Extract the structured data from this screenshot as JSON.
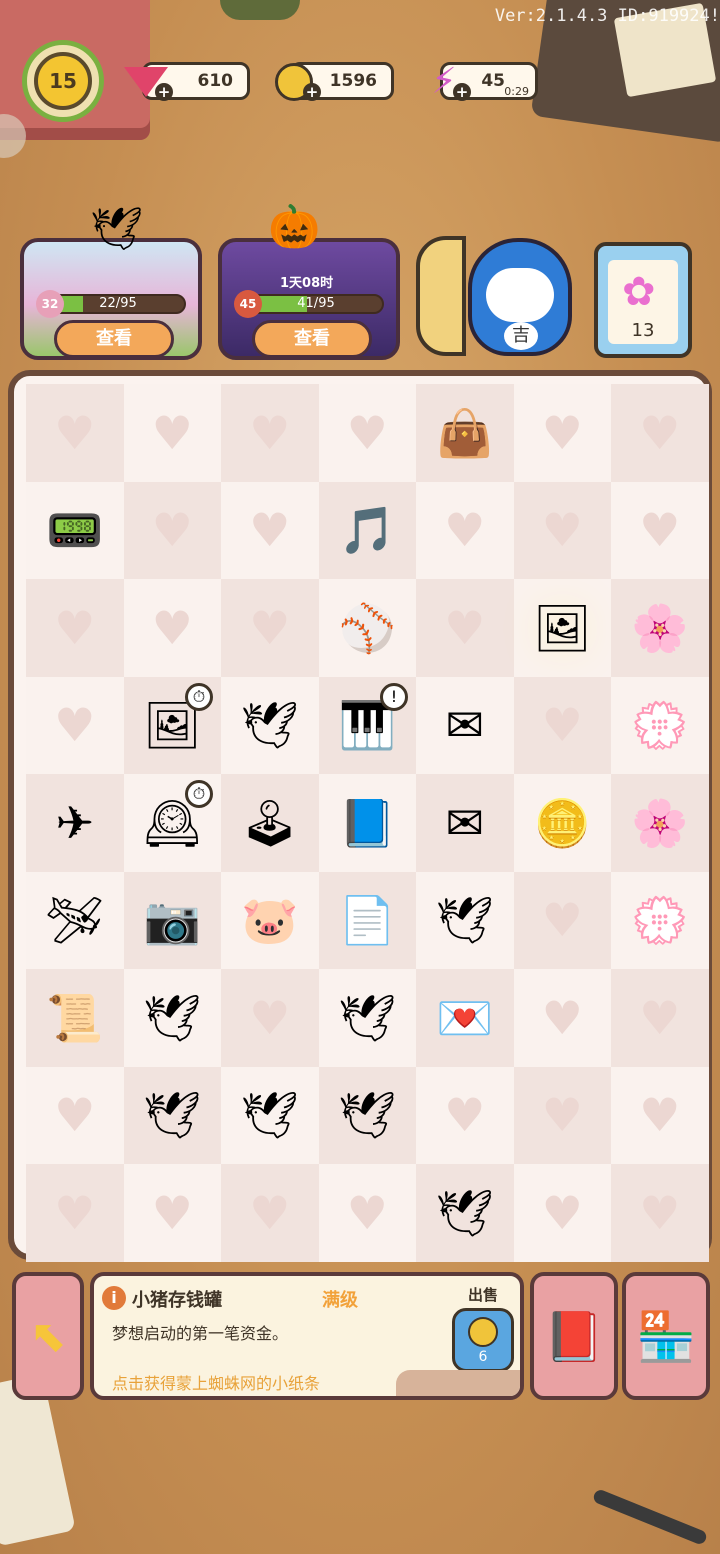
{
  "version": "Ver:2.1.4.3 ID:919924!",
  "player": {
    "level": "15"
  },
  "resources": {
    "gems": {
      "value": "610",
      "icon": "gem-icon",
      "color": "#e0446a"
    },
    "coins": {
      "value": "1596",
      "icon": "coin-icon",
      "color": "#f0c43a"
    },
    "energy": {
      "value": "45",
      "timer": "0:29",
      "icon": "lightning-icon",
      "color": "#d25cc8"
    }
  },
  "events": [
    {
      "name": "sakura-event",
      "level": "32",
      "progress_text": "22/95",
      "progress": 0.2316,
      "button": "查看"
    },
    {
      "name": "halloween-event",
      "level": "45",
      "progress_text": "41/95",
      "progress": 0.4316,
      "timer": "1天08时",
      "button": "查看"
    }
  ],
  "side_widgets": {
    "daruma_mark": "吉",
    "clipboard_count": "13"
  },
  "board": {
    "cols": 7,
    "rows": 9,
    "cells": [
      [
        "",
        "",
        "",
        "",
        "bag",
        "",
        ""
      ],
      [
        "circuit",
        "",
        "",
        "music",
        "",
        "",
        ""
      ],
      [
        "",
        "",
        "",
        "baseball",
        "",
        "photos",
        "flower"
      ],
      [
        "",
        "photoframe",
        "crane-web",
        "piano",
        "envelope-web",
        "",
        "flower-heart"
      ],
      [
        "plane-web",
        "clock",
        "arcade",
        "book",
        "envelope-web",
        "coins",
        "flower"
      ],
      [
        "plane",
        "camera",
        "piggy",
        "letter",
        "crane-web",
        "",
        "flower-glow"
      ],
      [
        "papers",
        "crane-web",
        "",
        "crane-web",
        "loveletter",
        "",
        ""
      ],
      [
        "",
        "crane-web",
        "crane-web",
        "crane-web",
        "",
        "",
        ""
      ],
      [
        "",
        "",
        "",
        "",
        "crane-web",
        "",
        ""
      ]
    ]
  },
  "item_info": {
    "name": "小猪存钱罐",
    "level": "满级",
    "description": "梦想启动的第一笔资金。",
    "tip": "点击获得蒙上蜘蛛网的小纸条",
    "sell_label": "出售",
    "sell_price": "6"
  }
}
